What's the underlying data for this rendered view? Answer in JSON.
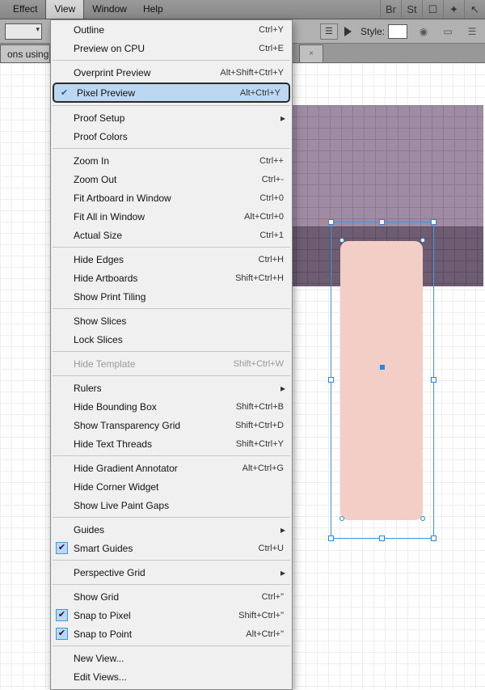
{
  "menubar": {
    "items": [
      "Effect",
      "View",
      "Window",
      "Help"
    ],
    "active": "View",
    "right_icons": [
      "Br",
      "St",
      "arrange-icon",
      "plugin-icon",
      "cursor-icon"
    ]
  },
  "optionsbar": {
    "style_label": "Style:"
  },
  "tabs": {
    "label": "ons using Illu",
    "extra_close": "×"
  },
  "menu": [
    {
      "type": "item",
      "label": "Outline",
      "shortcut": "Ctrl+Y"
    },
    {
      "type": "item",
      "label": "Preview on CPU",
      "shortcut": "Ctrl+E"
    },
    {
      "type": "sep"
    },
    {
      "type": "item",
      "label": "Overprint Preview",
      "shortcut": "Alt+Shift+Ctrl+Y"
    },
    {
      "type": "item",
      "label": "Pixel Preview",
      "shortcut": "Alt+Ctrl+Y",
      "checked": true,
      "highlighted": true,
      "boxed": true
    },
    {
      "type": "sep"
    },
    {
      "type": "sub",
      "label": "Proof Setup"
    },
    {
      "type": "item",
      "label": "Proof Colors"
    },
    {
      "type": "sep"
    },
    {
      "type": "item",
      "label": "Zoom In",
      "shortcut": "Ctrl++"
    },
    {
      "type": "item",
      "label": "Zoom Out",
      "shortcut": "Ctrl+-"
    },
    {
      "type": "item",
      "label": "Fit Artboard in Window",
      "shortcut": "Ctrl+0"
    },
    {
      "type": "item",
      "label": "Fit All in Window",
      "shortcut": "Alt+Ctrl+0"
    },
    {
      "type": "item",
      "label": "Actual Size",
      "shortcut": "Ctrl+1"
    },
    {
      "type": "sep"
    },
    {
      "type": "item",
      "label": "Hide Edges",
      "shortcut": "Ctrl+H"
    },
    {
      "type": "item",
      "label": "Hide Artboards",
      "shortcut": "Shift+Ctrl+H"
    },
    {
      "type": "item",
      "label": "Show Print Tiling"
    },
    {
      "type": "sep"
    },
    {
      "type": "item",
      "label": "Show Slices"
    },
    {
      "type": "item",
      "label": "Lock Slices"
    },
    {
      "type": "sep"
    },
    {
      "type": "item",
      "label": "Hide Template",
      "shortcut": "Shift+Ctrl+W",
      "disabled": true
    },
    {
      "type": "sep"
    },
    {
      "type": "sub",
      "label": "Rulers"
    },
    {
      "type": "item",
      "label": "Hide Bounding Box",
      "shortcut": "Shift+Ctrl+B"
    },
    {
      "type": "item",
      "label": "Show Transparency Grid",
      "shortcut": "Shift+Ctrl+D"
    },
    {
      "type": "item",
      "label": "Hide Text Threads",
      "shortcut": "Shift+Ctrl+Y"
    },
    {
      "type": "sep"
    },
    {
      "type": "item",
      "label": "Hide Gradient Annotator",
      "shortcut": "Alt+Ctrl+G"
    },
    {
      "type": "item",
      "label": "Hide Corner Widget"
    },
    {
      "type": "item",
      "label": "Show Live Paint Gaps"
    },
    {
      "type": "sep"
    },
    {
      "type": "sub",
      "label": "Guides"
    },
    {
      "type": "item",
      "label": "Smart Guides",
      "shortcut": "Ctrl+U",
      "checked": true,
      "bluecheck": true
    },
    {
      "type": "sep"
    },
    {
      "type": "sub",
      "label": "Perspective Grid"
    },
    {
      "type": "sep"
    },
    {
      "type": "item",
      "label": "Show Grid",
      "shortcut": "Ctrl+\""
    },
    {
      "type": "item",
      "label": "Snap to Pixel",
      "shortcut": "Shift+Ctrl+\"",
      "checked": true,
      "bluecheck": true
    },
    {
      "type": "item",
      "label": "Snap to Point",
      "shortcut": "Alt+Ctrl+\"",
      "checked": true,
      "bluecheck": true
    },
    {
      "type": "sep"
    },
    {
      "type": "item",
      "label": "New View..."
    },
    {
      "type": "item",
      "label": "Edit Views..."
    }
  ]
}
